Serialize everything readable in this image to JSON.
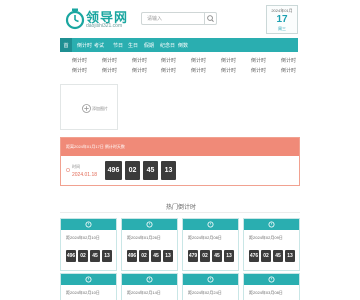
{
  "header": {
    "logo_title": "领导网",
    "logo_sub": "daojishi321.com",
    "search_placeholder": "请输入",
    "calendar": {
      "date": "2024年01月",
      "day": "17",
      "weekday": "周三"
    }
  },
  "nav": {
    "items": [
      "首",
      "倒计时",
      "考试",
      "节日",
      "生日",
      "假期",
      "纪念日",
      "倒数"
    ],
    "sub_items": [
      [
        "倒计时",
        "倒计时",
        "倒计时",
        "倒计时",
        "倒计时",
        "倒计时",
        "倒计时",
        "倒计时"
      ],
      [
        "倒计时",
        "倒计时",
        "倒计时",
        "倒计时",
        "倒计时",
        "倒计时",
        "倒计时",
        "倒计时"
      ]
    ]
  },
  "image_box": {
    "label": "添加图片"
  },
  "banner": {
    "head_text": "距离2024年01月17日 倒计时天数",
    "period_label": "时间",
    "date": "2024.01.18",
    "digits": [
      "496",
      "02",
      "45",
      "13"
    ]
  },
  "section": {
    "title": "热门倒计时"
  },
  "cards": [
    {
      "title": "距2024年02月10日",
      "digits": [
        "496",
        "02",
        "45",
        "13"
      ]
    },
    {
      "title": "距2024年01月26日",
      "digits": [
        "496",
        "02",
        "45",
        "13"
      ]
    },
    {
      "title": "距2024年02月08日",
      "digits": [
        "479",
        "02",
        "45",
        "13"
      ]
    },
    {
      "title": "距2024年02月09日",
      "digits": [
        "476",
        "02",
        "45",
        "13"
      ]
    },
    {
      "title": "距2024年02月10日",
      "digits": []
    },
    {
      "title": "距2024年02月14日",
      "digits": []
    },
    {
      "title": "距2024年02月24日",
      "digits": []
    },
    {
      "title": "距2024年03月08日",
      "digits": []
    }
  ]
}
